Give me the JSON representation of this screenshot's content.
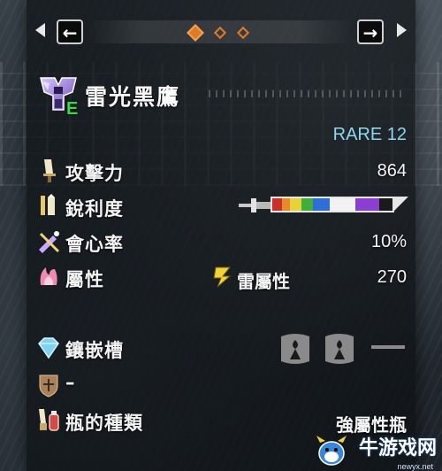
{
  "nav": {
    "left_key": "←",
    "right_key": "→",
    "page_count": 3,
    "active_page": 1
  },
  "weapon": {
    "name": "雷光黑鷹",
    "rank_letter": "E",
    "rarity": "RARE 12"
  },
  "stats": {
    "attack": {
      "label": "攻擊力",
      "value": "864"
    },
    "sharpness": {
      "label": "銳利度",
      "segments": [
        {
          "color": "#c8322a",
          "fraction": 0.08
        },
        {
          "color": "#e68a2a",
          "fraction": 0.07
        },
        {
          "color": "#e8d23a",
          "fraction": 0.09
        },
        {
          "color": "#3fae3a",
          "fraction": 0.1
        },
        {
          "color": "#2f6ed6",
          "fraction": 0.14
        },
        {
          "color": "#f2f2f2",
          "fraction": 0.21
        },
        {
          "color": "#8b3fcf",
          "fraction": 0.2
        },
        {
          "color": "#1a1a1a",
          "fraction": 0.11
        }
      ]
    },
    "affinity": {
      "label": "會心率",
      "value": "10%"
    },
    "element": {
      "label": "屬性",
      "type_label": "雷屬性",
      "value": "270"
    },
    "slots": {
      "label": "鑲嵌槽",
      "filled_count": 2,
      "empty_slot_label": "—"
    },
    "armor_skill": {
      "value": "–"
    },
    "phial": {
      "label": "瓶的種類",
      "value": "強屬性瓶"
    }
  },
  "watermark": {
    "text": "牛游戏网",
    "url": "newyx.net"
  },
  "colors": {
    "accent_orange": "#e07a2a",
    "rarity_cyan": "#8fd6ef",
    "rank_green": "#3ad84a"
  }
}
